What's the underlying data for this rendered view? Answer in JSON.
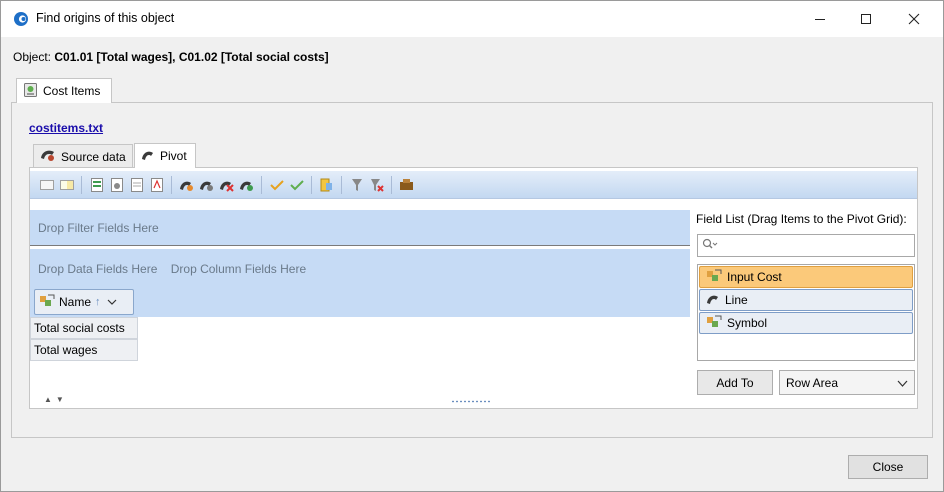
{
  "window": {
    "title": "Find origins of this object",
    "controls": {
      "minimize": "minimize-icon",
      "maximize": "maximize-icon",
      "close": "close-icon"
    }
  },
  "object": {
    "prefix": "Object:",
    "value": "C01.01 [Total wages], C01.02 [Total social costs]"
  },
  "outer_tab": {
    "label": "Cost Items"
  },
  "file_link": "costitems.txt",
  "inner_tabs": [
    {
      "label": "Source data",
      "active": false
    },
    {
      "label": "Pivot",
      "active": true
    }
  ],
  "pivot": {
    "filter_hint": "Drop Filter Fields Here",
    "data_hint": "Drop Data Fields Here",
    "column_hint": "Drop Column Fields Here",
    "row_field": {
      "label": "Name",
      "sort": "ascending"
    },
    "rows": [
      "Total social costs",
      "Total wages"
    ]
  },
  "field_list": {
    "title": "Field List (Drag Items to the Pivot Grid):",
    "search_placeholder": "",
    "items": [
      {
        "label": "Input Cost",
        "selected": true
      },
      {
        "label": "Line",
        "selected": false
      },
      {
        "label": "Symbol",
        "selected": false
      }
    ],
    "add_to_label": "Add To",
    "area_selected": "Row Area"
  },
  "footer": {
    "close_label": "Close"
  },
  "colors": {
    "accent": "#c6dbf5",
    "selected_field": "#fbc97a",
    "link": "#1a0dab"
  }
}
